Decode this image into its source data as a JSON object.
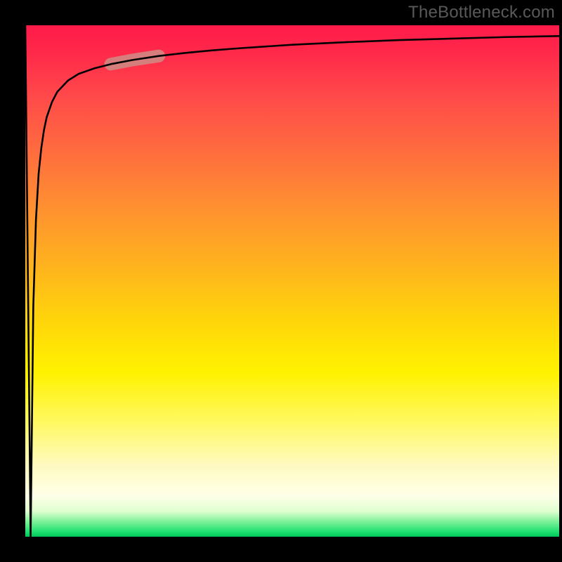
{
  "attribution": "TheBottleneck.com",
  "chart_data": {
    "type": "line",
    "title": "",
    "xlabel": "",
    "ylabel": "",
    "xlim": [
      0,
      100
    ],
    "ylim": [
      0,
      100
    ],
    "series": [
      {
        "name": "curve",
        "x": [
          0,
          0.5,
          1,
          1.5,
          2,
          2.5,
          3,
          3.5,
          4,
          5,
          6,
          8,
          10,
          13,
          16,
          20,
          25,
          30,
          35,
          40,
          50,
          60,
          70,
          80,
          90,
          100
        ],
        "y": [
          100,
          50,
          0,
          45,
          62,
          71,
          76,
          79.5,
          82,
          85,
          87,
          89.2,
          90.5,
          91.6,
          92.4,
          93.2,
          94.0,
          94.6,
          95.1,
          95.5,
          96.2,
          96.7,
          97.1,
          97.4,
          97.7,
          97.9
        ]
      }
    ],
    "highlight_segment": {
      "x_start": 16,
      "x_end": 25
    },
    "gradient_stops": [
      {
        "pos": 0.0,
        "color": "#ff1a4a"
      },
      {
        "pos": 0.24,
        "color": "#ff6a3f"
      },
      {
        "pos": 0.58,
        "color": "#ffd60a"
      },
      {
        "pos": 0.92,
        "color": "#ffffe8"
      },
      {
        "pos": 1.0,
        "color": "#00c85a"
      }
    ]
  }
}
